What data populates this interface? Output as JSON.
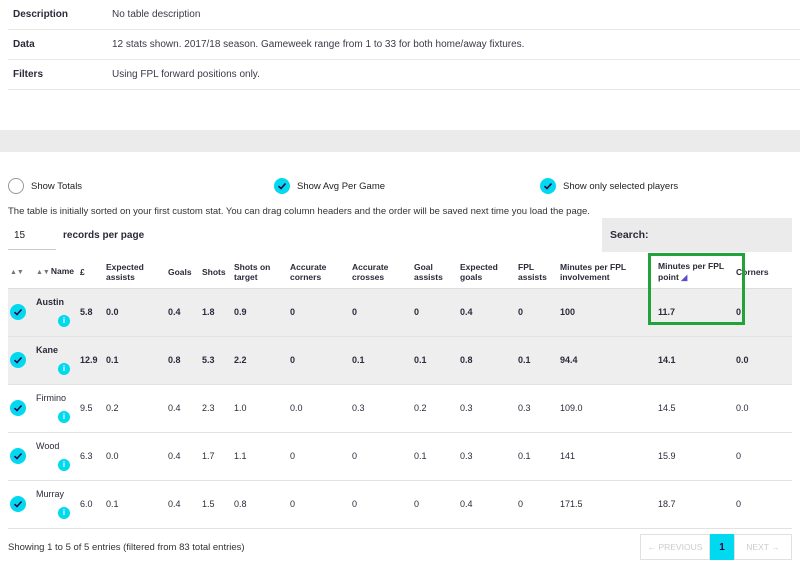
{
  "info": [
    {
      "label": "Description",
      "value": "No table description"
    },
    {
      "label": "Data",
      "value": "12 stats shown. 2017/18 season. Gameweek range from 1 to 33 for both home/away fixtures."
    },
    {
      "label": "Filters",
      "value": "Using FPL forward positions only."
    }
  ],
  "toggles": {
    "totals": "Show Totals",
    "avg": "Show Avg Per Game",
    "selected": "Show only selected players"
  },
  "hint": "The table is initially sorted on your first custom stat. You can drag column headers and the order will be saved next time you load the page.",
  "records": {
    "value": "15",
    "label": "records per page"
  },
  "search": {
    "label": "Search:"
  },
  "columns": [
    "Name",
    "£",
    "Expected assists",
    "Goals",
    "Shots",
    "Shots on target",
    "Accurate corners",
    "Accurate crosses",
    "Goal assists",
    "Expected goals",
    "FPL assists",
    "Minutes per FPL involvement",
    "Minutes per FPL point",
    "Corners"
  ],
  "rows": [
    {
      "name": "Austin",
      "cells": [
        "5.8",
        "0.0",
        "0.4",
        "1.8",
        "0.9",
        "0",
        "0",
        "0",
        "0.4",
        "0",
        "100",
        "11.7",
        "0"
      ]
    },
    {
      "name": "Kane",
      "cells": [
        "12.9",
        "0.1",
        "0.8",
        "5.3",
        "2.2",
        "0",
        "0.1",
        "0.1",
        "0.8",
        "0.1",
        "94.4",
        "14.1",
        "0.0"
      ]
    },
    {
      "name": "Firmino",
      "cells": [
        "9.5",
        "0.2",
        "0.4",
        "2.3",
        "1.0",
        "0.0",
        "0.3",
        "0.2",
        "0.3",
        "0.3",
        "109.0",
        "14.5",
        "0.0"
      ]
    },
    {
      "name": "Wood",
      "cells": [
        "6.3",
        "0.0",
        "0.4",
        "1.7",
        "1.1",
        "0",
        "0",
        "0.1",
        "0.3",
        "0.1",
        "141",
        "15.9",
        "0"
      ]
    },
    {
      "name": "Murray",
      "cells": [
        "6.0",
        "0.1",
        "0.4",
        "1.5",
        "0.8",
        "0",
        "0",
        "0",
        "0.4",
        "0",
        "171.5",
        "18.7",
        "0"
      ]
    }
  ],
  "info_icon": "i",
  "footer": {
    "entries": "Showing 1 to 5 of 5 entries (filtered from 83 total entries)"
  },
  "pager": {
    "prev": "← PREVIOUS",
    "current": "1",
    "next": "NEXT →"
  },
  "colors": {
    "accent": "#00d9f0",
    "highlight": "#1fa33a"
  }
}
